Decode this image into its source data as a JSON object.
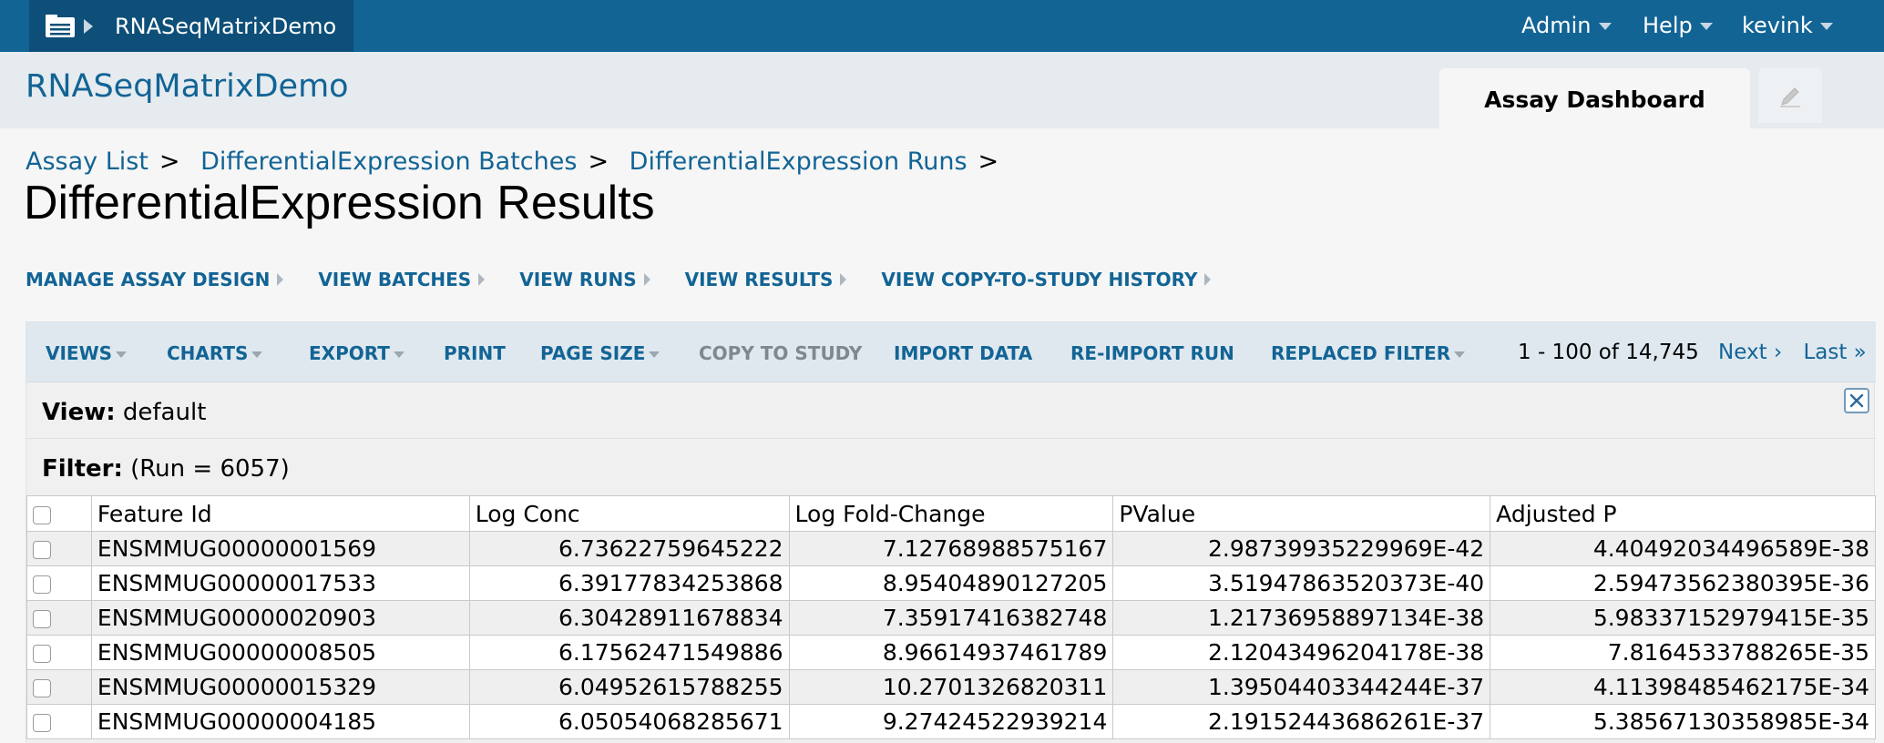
{
  "header": {
    "project_name": "RNASeqMatrixDemo",
    "menus": [
      "Admin",
      "Help",
      "kevink"
    ]
  },
  "subheader": {
    "project_title": "RNASeqMatrixDemo",
    "tab_label": "Assay Dashboard"
  },
  "breadcrumbs": [
    "Assay List",
    "DifferentialExpression Batches",
    "DifferentialExpression Runs"
  ],
  "breadcrumb_separator": ">",
  "page_title": "DifferentialExpression Results",
  "actions": [
    "MANAGE ASSAY DESIGN",
    "VIEW BATCHES",
    "VIEW RUNS",
    "VIEW RESULTS",
    "VIEW COPY-TO-STUDY HISTORY"
  ],
  "grid_toolbar": {
    "views": "VIEWS",
    "charts": "CHARTS",
    "export": "EXPORT",
    "print": "PRINT",
    "page_size": "PAGE SIZE",
    "copy_to_study": "COPY TO STUDY",
    "import_data": "IMPORT DATA",
    "reimport_run": "RE-IMPORT RUN",
    "replaced_filter": "REPLACED FILTER",
    "paging_text": "1 - 100 of 14,745",
    "next": "Next ›",
    "last": "Last »"
  },
  "view_message": {
    "label": "View:",
    "value": "default"
  },
  "filter_message": {
    "label": "Filter:",
    "value": "(Run = 6057)"
  },
  "table": {
    "columns": [
      "Feature Id",
      "Log Conc",
      "Log Fold-Change",
      "PValue",
      "Adjusted P"
    ],
    "rows": [
      [
        "ENSMMUG00000001569",
        "6.73622759645222",
        "7.12768988575167",
        "2.98739935229969E-42",
        "4.40492034496589E-38"
      ],
      [
        "ENSMMUG00000017533",
        "6.39177834253868",
        "8.95404890127205",
        "3.51947863520373E-40",
        "2.59473562380395E-36"
      ],
      [
        "ENSMMUG00000020903",
        "6.30428911678834",
        "7.35917416382748",
        "1.21736958897134E-38",
        "5.98337152979415E-35"
      ],
      [
        "ENSMMUG00000008505",
        "6.17562471549886",
        "8.96614937461789",
        "2.12043496204178E-38",
        "7.8164533788265E-35"
      ],
      [
        "ENSMMUG00000015329",
        "6.04952615788255",
        "10.2701326820311",
        "1.39504403344244E-37",
        "4.11398485462175E-34"
      ],
      [
        "ENSMMUG00000004185",
        "6.05054068285671",
        "9.27424522939214",
        "2.19152443686261E-37",
        "5.38567130358985E-34"
      ]
    ]
  },
  "colors": {
    "header_blue": "#126495",
    "header_dark": "#0d4f78",
    "subheader_bg": "#e6ebef",
    "toolbar_bg": "#dfe8ef",
    "link": "#126495"
  }
}
